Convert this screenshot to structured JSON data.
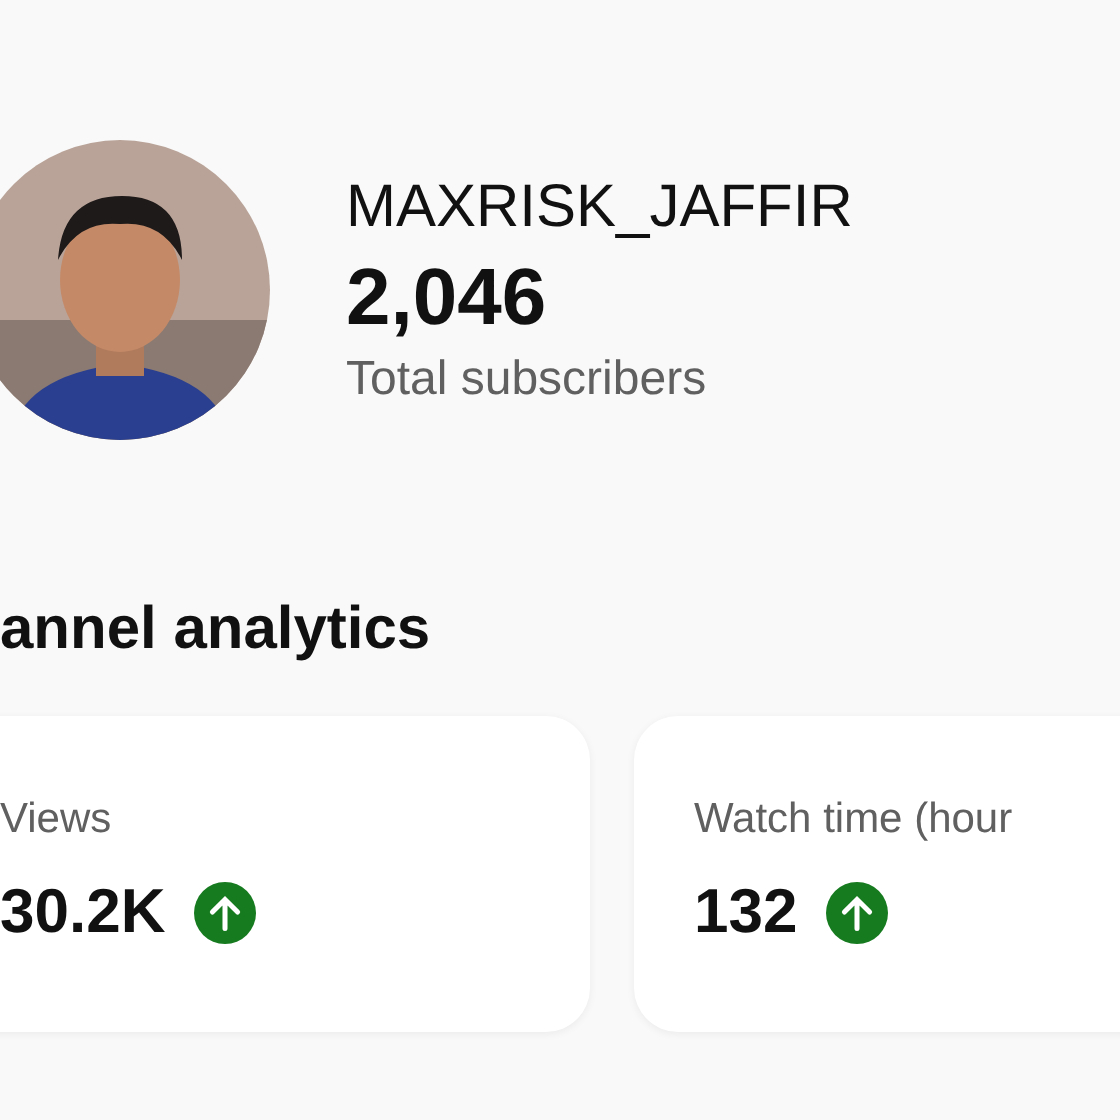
{
  "channel": {
    "name": "MAXRISK_JAFFIR",
    "subscribers": "2,046",
    "subscribers_label": "Total subscribers"
  },
  "section": {
    "title": "annel analytics"
  },
  "metrics": [
    {
      "label": "Views",
      "value": "30.2K",
      "kind": "up"
    },
    {
      "label": "Watch time (hour",
      "value": "132",
      "kind": "up"
    }
  ]
}
